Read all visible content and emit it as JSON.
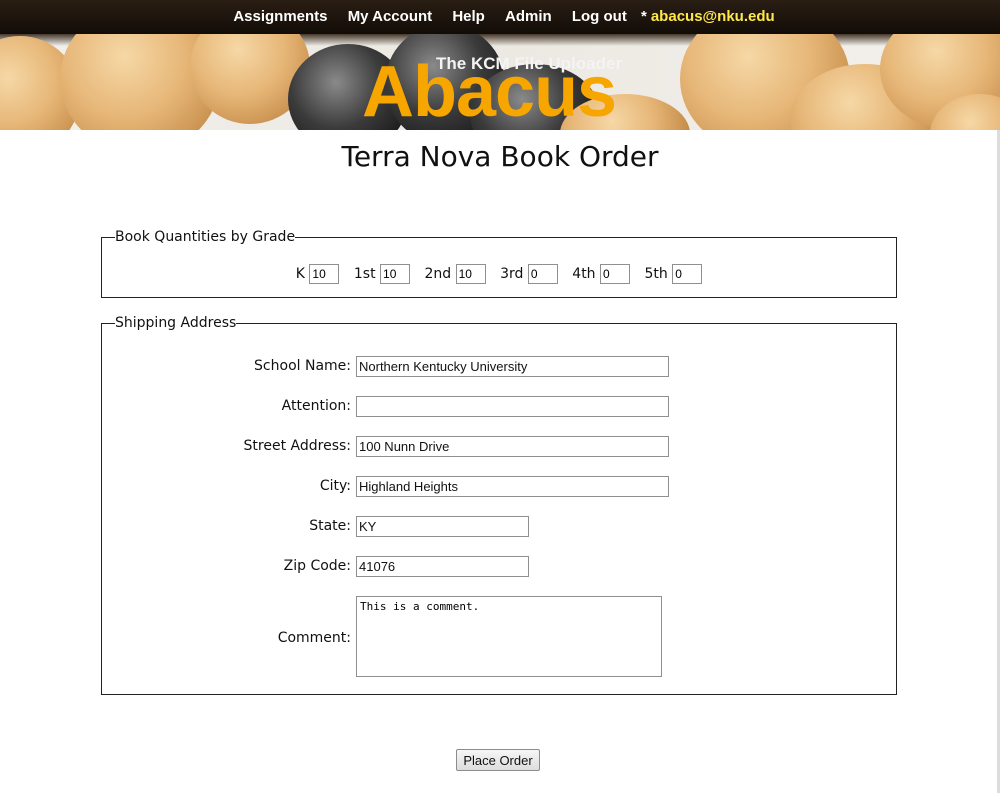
{
  "nav": {
    "items": [
      {
        "label": "Assignments"
      },
      {
        "label": "My Account"
      },
      {
        "label": "Help"
      },
      {
        "label": "Admin"
      },
      {
        "label": "Log out"
      }
    ],
    "user_prefix": "*",
    "user_email": "abacus@nku.edu"
  },
  "banner": {
    "subtitle": "The KCM File Uploader",
    "title": "Abacus"
  },
  "page_title": "Terra Nova Book Order",
  "grades": {
    "legend": "Book Quantities by Grade",
    "items": [
      {
        "label": "K",
        "value": "10"
      },
      {
        "label": "1st",
        "value": "10"
      },
      {
        "label": "2nd",
        "value": "10"
      },
      {
        "label": "3rd",
        "value": "0"
      },
      {
        "label": "4th",
        "value": "0"
      },
      {
        "label": "5th",
        "value": "0"
      }
    ]
  },
  "shipping": {
    "legend": "Shipping Address",
    "school_name": {
      "label": "School Name:",
      "value": "Northern Kentucky University"
    },
    "attention": {
      "label": "Attention:",
      "value": ""
    },
    "street": {
      "label": "Street Address:",
      "value": "100 Nunn Drive"
    },
    "city": {
      "label": "City:",
      "value": "Highland Heights"
    },
    "state": {
      "label": "State:",
      "value": "KY"
    },
    "zip": {
      "label": "Zip Code:",
      "value": "41076"
    },
    "comment": {
      "label": "Comment:",
      "value": "This is a comment."
    }
  },
  "submit_label": "Place Order",
  "colors": {
    "nav_bg": "#1a120b",
    "email": "#ffe84a",
    "brand": "#f7a600"
  }
}
